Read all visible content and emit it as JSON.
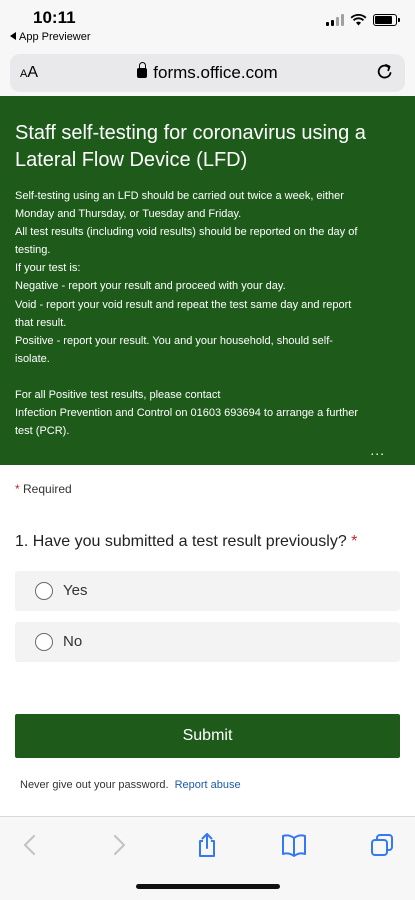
{
  "status_bar": {
    "time": "10:11",
    "back_app": "App Previewer"
  },
  "browser": {
    "text_size_label": "AA",
    "url": "forms.office.com"
  },
  "form": {
    "title": "Staff self-testing for coronavirus using a Lateral Flow Device (LFD)",
    "description": [
      "Self-testing using an LFD should be carried out twice a week, either",
      "Monday and Thursday, or Tuesday and Friday.",
      "All test results (including void results) should be reported on the day of",
      "testing.",
      "If your test is:",
      "Negative - report your result and proceed with your day.",
      "Void - report your void result and repeat the test same day and report",
      "that result.",
      "Positive - report your result. You and your household, should self-",
      "isolate.",
      "",
      "For all Positive test results, please contact",
      "Infection Prevention and Control on 01603 693694 to arrange a further",
      "test (PCR)."
    ],
    "more_label": "...",
    "required_star": "*",
    "required_label": "Required",
    "question": {
      "text": "1. Have you submitted a test result previously?",
      "required_marker": "*",
      "options": [
        "Yes",
        "No"
      ]
    },
    "submit_label": "Submit",
    "footer_note": "Never give out your password.",
    "report_link": "Report abuse"
  },
  "colors": {
    "brand_green": "#1e5b1b",
    "required_red": "#c4262e",
    "link_blue": "#1e5aa8",
    "ios_blue": "#3478f6"
  },
  "icons": {
    "toolbar": [
      "back-icon",
      "forward-icon",
      "share-icon",
      "bookmarks-icon",
      "tabs-icon"
    ],
    "browser": [
      "lock-icon",
      "reload-icon"
    ]
  }
}
